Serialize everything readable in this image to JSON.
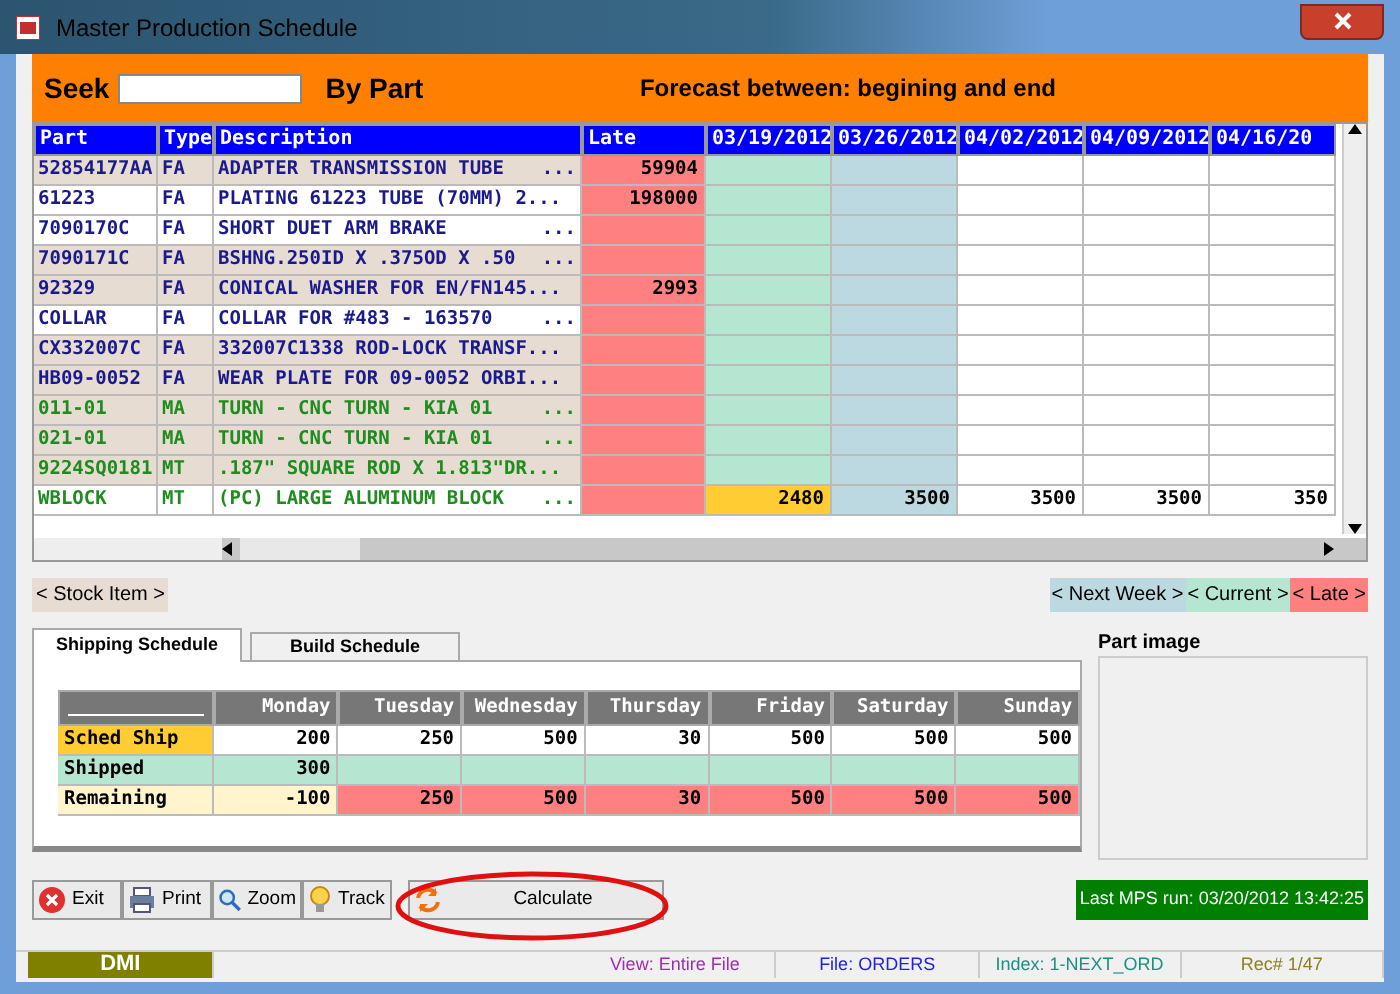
{
  "window": {
    "title": "Master Production Schedule"
  },
  "header": {
    "seek_label": "Seek",
    "by_label": "By Part",
    "forecast": "Forecast between:  begining and end"
  },
  "grid": {
    "columns": [
      "Part",
      "Type",
      "Description",
      "Late"
    ],
    "weeks": [
      "03/19/2012",
      "03/26/2012",
      "04/02/2012",
      "04/09/2012",
      "04/16/20"
    ],
    "rows": [
      {
        "part": "52854177AA",
        "type": "FA",
        "desc": "ADAPTER TRANSMISSION TUBE",
        "more": "...",
        "late": "59904",
        "stock_item": true,
        "color": "#1a1a8c",
        "weeks": [
          {
            "kind": "current"
          },
          {
            "kind": "next"
          },
          {
            "kind": "none"
          },
          {
            "kind": "none"
          },
          {
            "kind": "none"
          }
        ]
      },
      {
        "part": "61223",
        "type": "FA",
        "desc": "PLATING 61223 TUBE (70MM) 2...",
        "late": "198000",
        "stock_item": false,
        "color": "#1a1a8c",
        "weeks": [
          {
            "kind": "current"
          },
          {
            "kind": "next"
          },
          {
            "kind": "none"
          },
          {
            "kind": "none"
          },
          {
            "kind": "none"
          }
        ]
      },
      {
        "part": "7090170C",
        "type": "FA",
        "desc": "SHORT DUET ARM BRAKE",
        "more": "...",
        "stock_item": false,
        "color": "#1a1a8c",
        "weeks": [
          {
            "kind": "current"
          },
          {
            "kind": "next"
          },
          {
            "kind": "none"
          },
          {
            "kind": "none"
          },
          {
            "kind": "none"
          }
        ]
      },
      {
        "part": "7090171C",
        "type": "FA",
        "desc": "BSHNG.250ID X .375OD X .50",
        "more": "...",
        "stock_item": true,
        "color": "#1a1a8c",
        "weeks": [
          {
            "kind": "current"
          },
          {
            "kind": "next"
          },
          {
            "kind": "none"
          },
          {
            "kind": "none"
          },
          {
            "kind": "none"
          }
        ]
      },
      {
        "part": "92329",
        "type": "FA",
        "desc": "CONICAL WASHER FOR EN/FN145...",
        "late": "2993",
        "stock_item": true,
        "color": "#1a1a8c",
        "weeks": [
          {
            "kind": "current"
          },
          {
            "kind": "next"
          },
          {
            "kind": "none"
          },
          {
            "kind": "none"
          },
          {
            "kind": "none"
          }
        ]
      },
      {
        "part": "COLLAR",
        "type": "FA",
        "desc": "COLLAR FOR #483 - 163570",
        "more": "...",
        "stock_item": false,
        "color": "#1a1a8c",
        "weeks": [
          {
            "kind": "current"
          },
          {
            "kind": "next"
          },
          {
            "kind": "none"
          },
          {
            "kind": "none"
          },
          {
            "kind": "none"
          }
        ]
      },
      {
        "part": "CX332007C",
        "type": "FA",
        "desc": "332007C1338 ROD-LOCK TRANSF...",
        "stock_item": true,
        "color": "#1a1a8c",
        "weeks": [
          {
            "kind": "current"
          },
          {
            "kind": "next"
          },
          {
            "kind": "none"
          },
          {
            "kind": "none"
          },
          {
            "kind": "none"
          }
        ]
      },
      {
        "part": "HB09-0052",
        "type": "FA",
        "desc": "WEAR PLATE FOR 09-0052 ORBI...",
        "stock_item": true,
        "color": "#1a1a8c",
        "weeks": [
          {
            "kind": "current"
          },
          {
            "kind": "next"
          },
          {
            "kind": "none"
          },
          {
            "kind": "none"
          },
          {
            "kind": "none"
          }
        ]
      },
      {
        "part": "011-01",
        "type": "MA",
        "desc": "TURN - CNC TURN - KIA 01",
        "more": "...",
        "stock_item": true,
        "color": "#1e8c1e",
        "weeks": [
          {
            "kind": "current"
          },
          {
            "kind": "next"
          },
          {
            "kind": "none"
          },
          {
            "kind": "none"
          },
          {
            "kind": "none"
          }
        ]
      },
      {
        "part": "021-01",
        "type": "MA",
        "desc": "TURN - CNC TURN - KIA 01",
        "more": "...",
        "stock_item": true,
        "color": "#1e8c1e",
        "weeks": [
          {
            "kind": "current"
          },
          {
            "kind": "next"
          },
          {
            "kind": "none"
          },
          {
            "kind": "none"
          },
          {
            "kind": "none"
          }
        ]
      },
      {
        "part": "9224SQ0181",
        "type": "MT",
        "desc": ".187\" SQUARE ROD X 1.813\"DR...",
        "stock_item": true,
        "color": "#1e8c1e",
        "weeks": [
          {
            "kind": "current"
          },
          {
            "kind": "next"
          },
          {
            "kind": "none"
          },
          {
            "kind": "none"
          },
          {
            "kind": "none"
          }
        ]
      },
      {
        "part": "WBLOCK",
        "type": "MT",
        "desc": "(PC) LARGE ALUMINUM BLOCK",
        "more": "...",
        "stock_item": false,
        "color": "#1e8c1e",
        "weeks": [
          {
            "value": "2480",
            "kind": "short"
          },
          {
            "value": "3500",
            "kind": "next"
          },
          {
            "value": "3500",
            "kind": "none"
          },
          {
            "value": "3500",
            "kind": "none"
          },
          {
            "value": "350",
            "kind": "none"
          }
        ]
      }
    ]
  },
  "legend": [
    {
      "label": "< Stock Item >",
      "color": "#e6dcd2"
    },
    {
      "label": "< Next Week >",
      "color": "#bcd8e0"
    },
    {
      "label": "< Current >",
      "color": "#b4e6d2"
    },
    {
      "label": "< Late >",
      "color": "#ff8080"
    }
  ],
  "tabs": [
    {
      "label": "Shipping Schedule",
      "selected": true
    },
    {
      "label": "Build Schedule",
      "selected": false
    }
  ],
  "schedule": {
    "days": [
      "Monday",
      "Tuesday",
      "Wednesday",
      "Thursday",
      "Friday",
      "Saturday",
      "Sunday"
    ],
    "rows": [
      {
        "label": "Sched Ship",
        "color": "#ffcc33",
        "cells": [
          {
            "value": "200",
            "kind": "plain"
          },
          {
            "value": "250",
            "kind": "plain"
          },
          {
            "value": "500",
            "kind": "plain"
          },
          {
            "value": "30",
            "kind": "plain"
          },
          {
            "value": "500",
            "kind": "plain"
          },
          {
            "value": "500",
            "kind": "plain"
          },
          {
            "value": "500",
            "kind": "plain"
          }
        ]
      },
      {
        "label": "Shipped",
        "color": "#b4e6d2",
        "cells": [
          {
            "value": "300",
            "kind": "shipped"
          },
          {
            "kind": "shipped"
          },
          {
            "kind": "shipped"
          },
          {
            "kind": "shipped"
          },
          {
            "kind": "shipped"
          },
          {
            "kind": "shipped"
          },
          {
            "kind": "shipped"
          }
        ]
      },
      {
        "label": "Remaining",
        "color": "#fff4cc",
        "cells": [
          {
            "value": "-100",
            "kind": "pending"
          },
          {
            "value": "250",
            "kind": "short"
          },
          {
            "value": "500",
            "kind": "short"
          },
          {
            "value": "30",
            "kind": "short"
          },
          {
            "value": "500",
            "kind": "short"
          },
          {
            "value": "500",
            "kind": "short"
          },
          {
            "value": "500",
            "kind": "short"
          }
        ]
      }
    ]
  },
  "part_image": {
    "label": "Part image"
  },
  "buttons": [
    {
      "label": "Exit",
      "kind": "exit"
    },
    {
      "label": "Print",
      "kind": "print"
    },
    {
      "label": "Zoom",
      "kind": "zoom"
    },
    {
      "label": "Track",
      "kind": "track"
    },
    {
      "label": "Calculate",
      "kind": "calculate"
    }
  ],
  "last_run": "Last MPS run: 03/20/2012 13:42:25",
  "status_bar": [
    {
      "text": "DMI"
    },
    {
      "text": "View: Entire File",
      "color": "#9b2fae"
    },
    {
      "text": "File: ORDERS",
      "color": "#2020e0"
    },
    {
      "text": "Index: 1-NEXT_ORD",
      "color": "#1a9080"
    },
    {
      "text": "Rec# 1/47",
      "color": "#8c8020"
    }
  ]
}
